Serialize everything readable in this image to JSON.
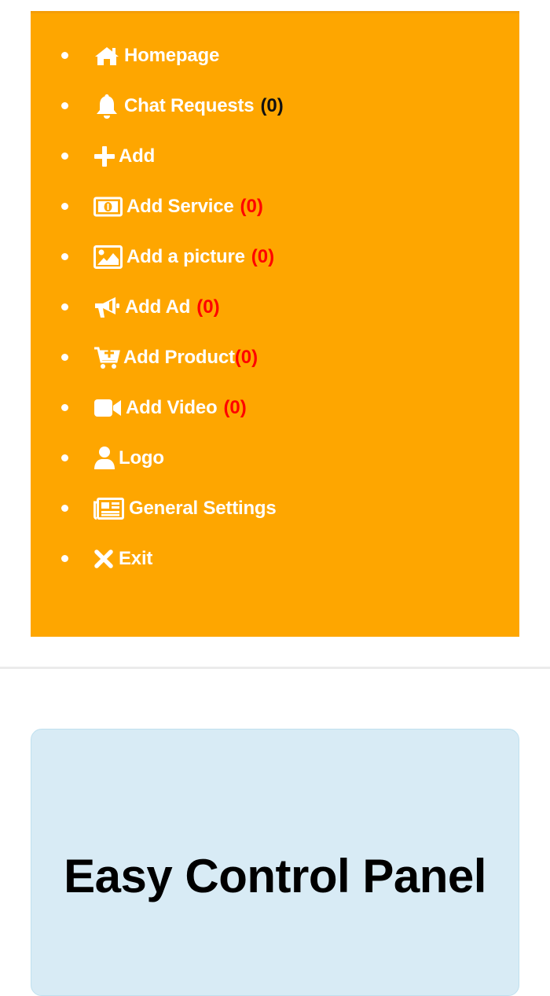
{
  "menu": {
    "items": [
      {
        "label": "Homepage",
        "icon": "home-icon",
        "count": ""
      },
      {
        "label": "Chat Requests",
        "icon": "bell-icon",
        "count": "(0)",
        "count_color": "#111111"
      },
      {
        "label": "Add",
        "icon": "plus-icon",
        "count": ""
      },
      {
        "label": "Add Service",
        "icon": "money-bill-icon",
        "count": "(0)",
        "count_color": "#ff0000"
      },
      {
        "label": "Add a picture",
        "icon": "image-icon",
        "count": "(0)",
        "count_color": "#ff0000"
      },
      {
        "label": "Add Ad",
        "icon": "megaphone-icon",
        "count": "(0)",
        "count_color": "#ff0000"
      },
      {
        "label": "Add Product",
        "icon": "cart-plus-icon",
        "count": "(0)",
        "count_color": "#ff0000"
      },
      {
        "label": "Add Video",
        "icon": "video-camera-icon",
        "count": "(0)",
        "count_color": "#ff0000"
      },
      {
        "label": "Logo",
        "icon": "user-icon",
        "count": ""
      },
      {
        "label": "General Settings",
        "icon": "newspaper-icon",
        "count": ""
      },
      {
        "label": "Exit",
        "icon": "close-icon",
        "count": ""
      }
    ],
    "background_color": "#fea600"
  },
  "card": {
    "title": "Easy Control Panel",
    "background_color": "#d8ebf5"
  }
}
